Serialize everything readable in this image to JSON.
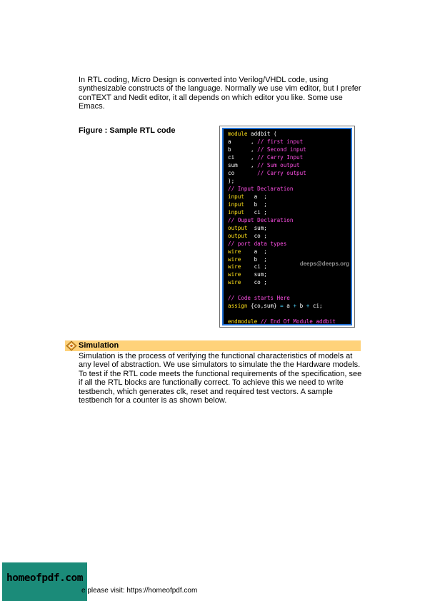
{
  "intro_text": " In RTL coding, Micro Design is converted into Verilog/VHDL code, using synthesizable constructs of the language. Normally we use vim editor, but I prefer conTEXT and Nedit editor, it all depends on which editor you like. Some use Emacs.",
  "figure_label": "Figure : Sample RTL code",
  "code_lines": [
    [
      {
        "t": "kw",
        "s": "module"
      },
      {
        "t": "pl",
        "s": " addbit ("
      }
    ],
    [
      {
        "t": "pl",
        "s": "a      , "
      },
      {
        "t": "cm",
        "s": "// first input"
      }
    ],
    [
      {
        "t": "pl",
        "s": "b      , "
      },
      {
        "t": "cm",
        "s": "// Second input"
      }
    ],
    [
      {
        "t": "pl",
        "s": "ci     , "
      },
      {
        "t": "cm",
        "s": "// Carry Input"
      }
    ],
    [
      {
        "t": "pl",
        "s": "sum    , "
      },
      {
        "t": "cm",
        "s": "// Sum output"
      }
    ],
    [
      {
        "t": "pl",
        "s": "co       "
      },
      {
        "t": "cm",
        "s": "// Carry output"
      }
    ],
    [
      {
        "t": "pl",
        "s": ");"
      }
    ],
    [
      {
        "t": "cm",
        "s": "// Input Declaration"
      }
    ],
    [
      {
        "t": "kw",
        "s": "input"
      },
      {
        "t": "pl",
        "s": "   a  ;"
      }
    ],
    [
      {
        "t": "kw",
        "s": "input"
      },
      {
        "t": "pl",
        "s": "   b  ;"
      }
    ],
    [
      {
        "t": "kw",
        "s": "input"
      },
      {
        "t": "pl",
        "s": "   ci ;"
      }
    ],
    [
      {
        "t": "cm",
        "s": "// Ouput Declaration"
      }
    ],
    [
      {
        "t": "kw",
        "s": "output"
      },
      {
        "t": "pl",
        "s": "  sum;"
      }
    ],
    [
      {
        "t": "kw",
        "s": "output"
      },
      {
        "t": "pl",
        "s": "  co ;"
      }
    ],
    [
      {
        "t": "cm",
        "s": "// port data types"
      }
    ],
    [
      {
        "t": "kw",
        "s": "wire"
      },
      {
        "t": "pl",
        "s": "    a  ;"
      }
    ],
    [
      {
        "t": "kw",
        "s": "wire"
      },
      {
        "t": "pl",
        "s": "    b  ;"
      }
    ],
    [
      {
        "t": "kw",
        "s": "wire"
      },
      {
        "t": "pl",
        "s": "    ci ;"
      }
    ],
    [
      {
        "t": "kw",
        "s": "wire"
      },
      {
        "t": "pl",
        "s": "    sum;"
      }
    ],
    [
      {
        "t": "kw",
        "s": "wire"
      },
      {
        "t": "pl",
        "s": "    co ;"
      }
    ],
    [
      {
        "t": "pl",
        "s": ""
      }
    ],
    [
      {
        "t": "cm",
        "s": "// Code starts Here"
      }
    ],
    [
      {
        "t": "kw",
        "s": "assign"
      },
      {
        "t": "pl",
        "s": " {co,sum} "
      },
      {
        "t": "op",
        "s": "="
      },
      {
        "t": "pl",
        "s": " a "
      },
      {
        "t": "op",
        "s": "+"
      },
      {
        "t": "pl",
        "s": " b "
      },
      {
        "t": "op",
        "s": "+"
      },
      {
        "t": "pl",
        "s": " ci;"
      }
    ],
    [
      {
        "t": "pl",
        "s": ""
      }
    ],
    [
      {
        "t": "kw",
        "s": "endmodule"
      },
      {
        "t": "pl",
        "s": " "
      },
      {
        "t": "cm",
        "s": "// End Of Module addbit"
      }
    ]
  ],
  "watermark": "deeps@deeps.org",
  "section_title": "Simulation",
  "simulation_text": "Simulation is the process of verifying the functional characteristics of models at any level of abstraction. We use simulators to simulate the the Hardware models. To test if the RTL code meets the functional requirements of the specification, see if all the RTL blocks are functionally correct. To achieve this we need to write testbench, which generates clk, reset and required test vectors. A sample testbench for a counter is as shown below.",
  "logo_text": "homeofpdf.com",
  "footer_text": "e please visit: https://homeofpdf.com",
  "icon": "section-bullet-icon",
  "colors": {
    "code_keyword": "#ffe11a",
    "code_comment": "#ff4fe6",
    "code_operator": "#4fd6ff",
    "code_background": "#000000",
    "code_border": "#1f6fd4",
    "section_bar": "#ffd27a",
    "logo_background": "#1b8b79"
  }
}
